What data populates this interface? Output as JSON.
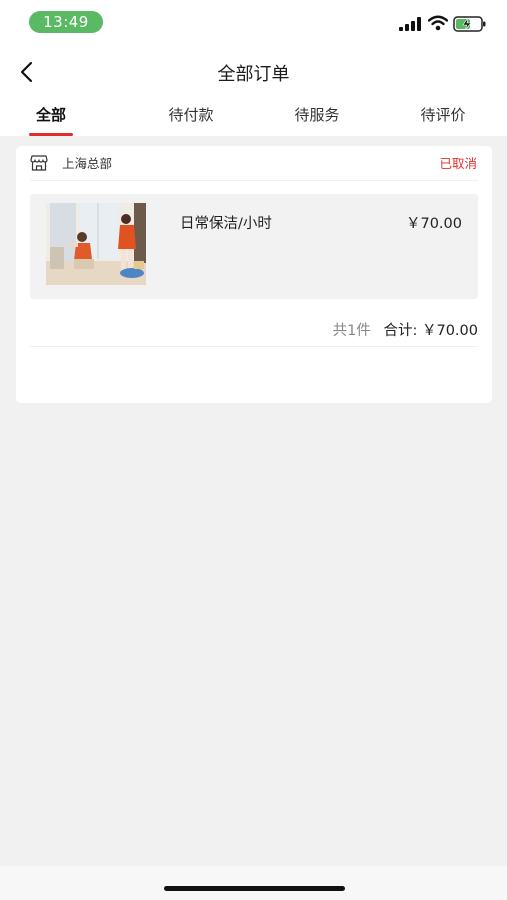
{
  "status_bar": {
    "time": "13:49",
    "icons": [
      "signal-icon",
      "wifi-icon",
      "battery-charging-icon"
    ],
    "time_pill_color": "#5ab963"
  },
  "nav": {
    "title": "全部订单",
    "back_icon": "chevron-left-icon"
  },
  "tabs": [
    {
      "label": "全部",
      "active": true
    },
    {
      "label": "待付款",
      "active": false
    },
    {
      "label": "待服务",
      "active": false
    },
    {
      "label": "待评价",
      "active": false
    }
  ],
  "order": {
    "shop_icon": "store-icon",
    "shop_name": "上海总部",
    "status": "已取消",
    "product": {
      "name": "日常保洁/小时",
      "price": "￥70.00"
    },
    "quantity_text": "共1件",
    "total_label": "合计:",
    "total_value": "￥70.00"
  },
  "colors": {
    "accent": "#e22b2b",
    "status_red": "#e0312f",
    "background": "#f1f1f1"
  }
}
